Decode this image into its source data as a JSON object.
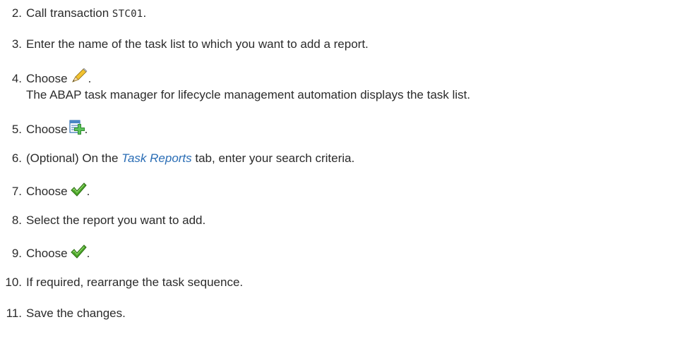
{
  "steps": [
    {
      "number": "2.",
      "text": "Call transaction ",
      "code": "STC01",
      "suffix": "."
    },
    {
      "number": "3.",
      "text": "Enter the name of the task list to which you want to add a report."
    },
    {
      "number": "4.",
      "text": "Choose",
      "icon": "pencil-icon",
      "suffix": ".",
      "result": "The ABAP task manager for lifecycle management automation displays the task list."
    },
    {
      "number": "5.",
      "text": "Choose",
      "icon": "add-row-icon",
      "suffix": "."
    },
    {
      "number": "6.",
      "prefix": "(Optional) On the ",
      "ui_term": "Task Reports",
      "text": " tab, enter your search criteria."
    },
    {
      "number": "7.",
      "text": "Choose",
      "icon": "checkmark-icon",
      "suffix": "."
    },
    {
      "number": "8.",
      "text": "Select the report you want to add."
    },
    {
      "number": "9.",
      "text": "Choose",
      "icon": "checkmark-icon",
      "suffix": "."
    },
    {
      "number": "10.",
      "text": "If required, rearrange the task sequence."
    },
    {
      "number": "11.",
      "text": "Save the changes."
    }
  ],
  "colors": {
    "text": "#2b2b2b",
    "ui_term": "#2a6db5",
    "check_green": "#3f9a1e",
    "add_green": "#2e8b2e"
  }
}
